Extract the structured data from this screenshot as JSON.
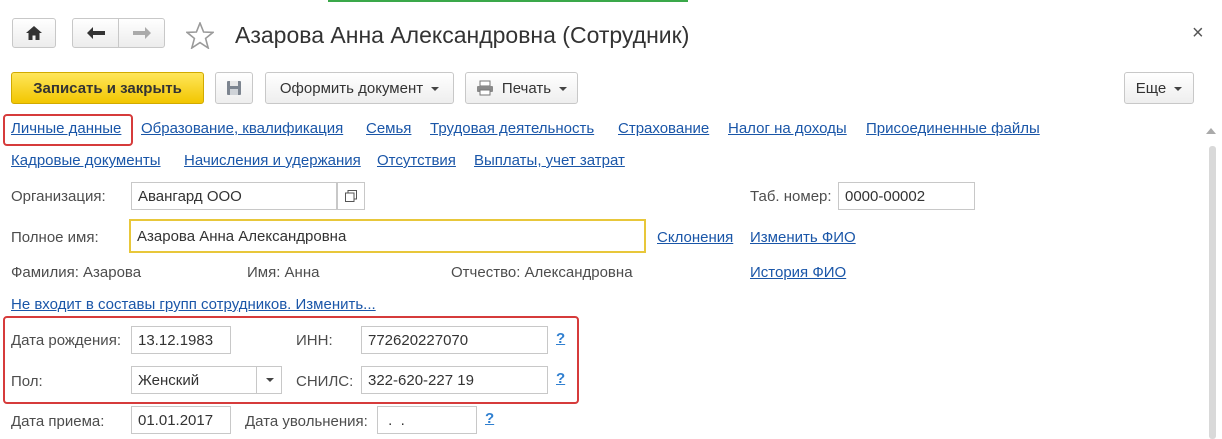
{
  "window": {
    "title": "Азарова Анна Александровна (Сотрудник)",
    "close_glyph": "×"
  },
  "toolbar": {
    "save_close": "Записать и закрыть",
    "create_document": "Оформить документ",
    "print": "Печать",
    "more": "Еще"
  },
  "tabs": {
    "row1": [
      "Личные данные",
      "Образование, квалификация",
      "Семья",
      "Трудовая деятельность",
      "Страхование",
      "Налог на доходы",
      "Присоединенные файлы"
    ],
    "row2": [
      "Кадровые документы",
      "Начисления и удержания",
      "Отсутствия",
      "Выплаты, учет затрат"
    ]
  },
  "form": {
    "organization_label": "Организация:",
    "organization_value": "Авангард ООО",
    "tab_number_label": "Таб. номер:",
    "tab_number_value": "0000-00002",
    "full_name_label": "Полное имя:",
    "full_name_value": "Азарова Анна Александровна",
    "declensions_link": "Склонения",
    "change_name_link": "Изменить ФИО",
    "surname": "Фамилия: Азарова",
    "first_name": "Имя: Анна",
    "patronymic": "Отчество: Александровна",
    "name_history_link": "История ФИО",
    "groups_link": "Не входит в составы групп сотрудников. Изменить...",
    "birth_date_label": "Дата рождения:",
    "birth_date_value": "13.12.1983",
    "inn_label": "ИНН:",
    "inn_value": "772620227070",
    "gender_label": "Пол:",
    "gender_value": "Женский",
    "snils_label": "СНИЛС:",
    "snils_value": "322-620-227 19",
    "hire_date_label": "Дата приема:",
    "hire_date_value": "01.01.2017",
    "dismissal_label": "Дата увольнения:",
    "dismissal_value": " .  . ",
    "help_glyph": "?"
  },
  "colors": {
    "accent_yellow": "#f2c600",
    "link": "#1a56a8",
    "highlight_red": "#d63b3b",
    "focus_border": "#e8c73a"
  }
}
